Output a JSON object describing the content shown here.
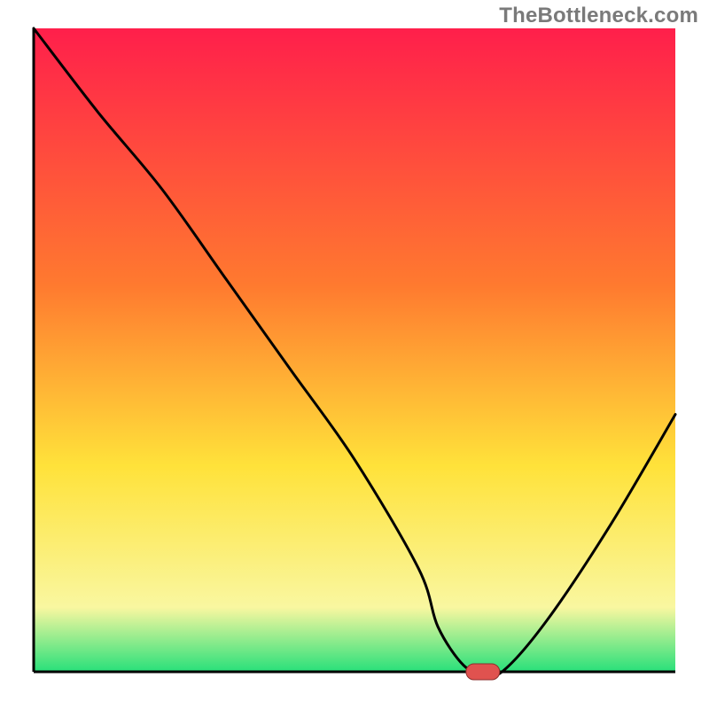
{
  "watermark": "TheBottleneck.com",
  "colors": {
    "gradient_top": "#ff1f4b",
    "gradient_mid1": "#ff7a2f",
    "gradient_mid2": "#ffe23a",
    "gradient_mid3": "#f9f7a0",
    "gradient_bottom": "#28e07a",
    "axis": "#000000",
    "curve": "#000000",
    "marker_fill": "#e0524f",
    "marker_stroke": "#8c2e2c"
  },
  "chart_data": {
    "type": "line",
    "title": "",
    "xlabel": "",
    "ylabel": "",
    "xlim": [
      0,
      100
    ],
    "ylim": [
      0,
      100
    ],
    "series": [
      {
        "name": "bottleneck-curve",
        "x": [
          0,
          10,
          20,
          30,
          40,
          50,
          60,
          63,
          67,
          70,
          73,
          80,
          90,
          100
        ],
        "values": [
          100,
          87,
          75,
          61,
          47,
          33,
          16,
          7,
          1,
          0,
          0,
          8,
          23,
          40
        ]
      }
    ],
    "annotations": [
      {
        "name": "optimal-marker",
        "x": 70,
        "y": 0
      }
    ],
    "background": "vertical-gradient red→orange→yellow→pale→green",
    "grid": false,
    "legend": false
  }
}
